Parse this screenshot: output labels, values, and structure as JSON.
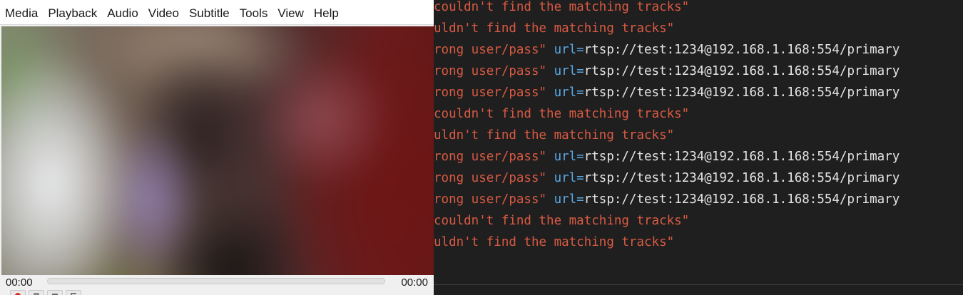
{
  "player": {
    "menu": [
      "Media",
      "Playback",
      "Audio",
      "Video",
      "Subtitle",
      "Tools",
      "View",
      "Help"
    ],
    "time_elapsed": "00:00",
    "time_total": "00:00",
    "seek_progress_percent": 0,
    "record_color": "#d93025"
  },
  "terminal": {
    "colors": {
      "error": "#d95a43",
      "key": "#59a9e6",
      "value": "#e4e4e4",
      "background": "#1f1f1f"
    },
    "lines": [
      {
        "type": "msg",
        "text": "couldn't find the matching tracks\""
      },
      {
        "type": "msg",
        "text": "uldn't find the matching tracks\""
      },
      {
        "type": "auth",
        "text": "rong user/pass\" ",
        "key": "url=",
        "value": "rtsp://test:1234@192.168.1.168:554/primary"
      },
      {
        "type": "auth",
        "text": "rong user/pass\" ",
        "key": "url=",
        "value": "rtsp://test:1234@192.168.1.168:554/primary"
      },
      {
        "type": "auth",
        "text": "rong user/pass\" ",
        "key": "url=",
        "value": "rtsp://test:1234@192.168.1.168:554/primary"
      },
      {
        "type": "msg",
        "text": "couldn't find the matching tracks\""
      },
      {
        "type": "msg",
        "text": "uldn't find the matching tracks\""
      },
      {
        "type": "auth",
        "text": "rong user/pass\" ",
        "key": "url=",
        "value": "rtsp://test:1234@192.168.1.168:554/primary"
      },
      {
        "type": "auth",
        "text": "rong user/pass\" ",
        "key": "url=",
        "value": "rtsp://test:1234@192.168.1.168:554/primary"
      },
      {
        "type": "auth",
        "text": "rong user/pass\" ",
        "key": "url=",
        "value": "rtsp://test:1234@192.168.1.168:554/primary"
      },
      {
        "type": "msg",
        "text": "couldn't find the matching tracks\""
      },
      {
        "type": "msg",
        "text": "uldn't find the matching tracks\""
      }
    ]
  }
}
